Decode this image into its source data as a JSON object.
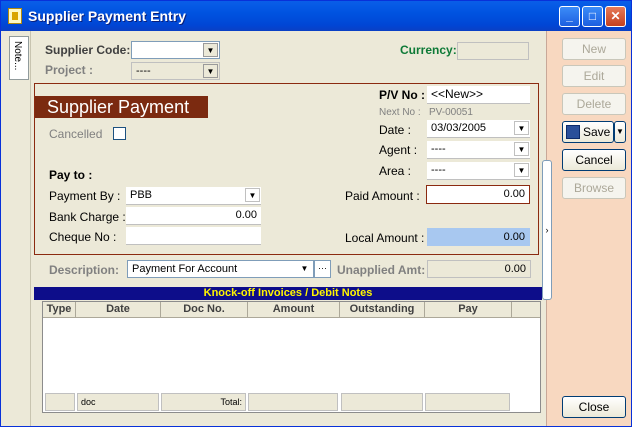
{
  "window": {
    "title": "Supplier Payment Entry",
    "controls": {
      "minimize": "_",
      "maximize": "□",
      "close": "✕"
    }
  },
  "side_tab": {
    "label": "Note..."
  },
  "header": {
    "supplier_code_label": "Supplier Code:",
    "supplier_code_value": "",
    "project_label": "Project :",
    "project_value": "----",
    "currency_label": "Currency:",
    "currency_value": ""
  },
  "panel": {
    "brand": "Supplier Payment",
    "cancelled_label": "Cancelled",
    "cancelled_checked": false,
    "pv_no_label": "P/V No :",
    "pv_no_value": "<<New>>",
    "next_no_label": "Next No :",
    "next_no_value": "PV-00051",
    "date_label": "Date :",
    "date_value": "03/03/2005",
    "agent_label": "Agent :",
    "agent_value": "----",
    "area_label": "Area :",
    "area_value": "----",
    "pay_to_label": "Pay to :",
    "payment_by_label": "Payment By :",
    "payment_by_value": "PBB",
    "bank_charge_label": "Bank Charge :",
    "bank_charge_value": "0.00",
    "cheque_no_label": "Cheque No :",
    "cheque_no_value": "",
    "paid_amount_label": "Paid Amount :",
    "paid_amount_value": "0.00",
    "local_amount_label": "Local Amount :",
    "local_amount_value": "0.00"
  },
  "description": {
    "label": "Description:",
    "value": "Payment For Account",
    "ellipsis": "···",
    "unapplied_label": "Unapplied Amt:",
    "unapplied_value": "0.00"
  },
  "grid": {
    "title": "Knock-off Invoices / Debit Notes",
    "columns": [
      "Type",
      "Date",
      "Doc No.",
      "Amount",
      "Outstanding",
      "Pay"
    ],
    "footer_doc": "doc",
    "footer_total": "Total:"
  },
  "buttons": {
    "new": "New",
    "edit": "Edit",
    "delete": "Delete",
    "save": "Save",
    "cancel": "Cancel",
    "browse": "Browse",
    "close": "Close"
  },
  "colors": {
    "brand_bg": "#7b2a10",
    "grid_title_bg": "#0d0d8a",
    "grid_title_fg": "#fff600",
    "right_pane_bg": "#f8d8c0",
    "local_amount_bg": "#a8c8f0",
    "currency_label": "#0e7a37"
  }
}
